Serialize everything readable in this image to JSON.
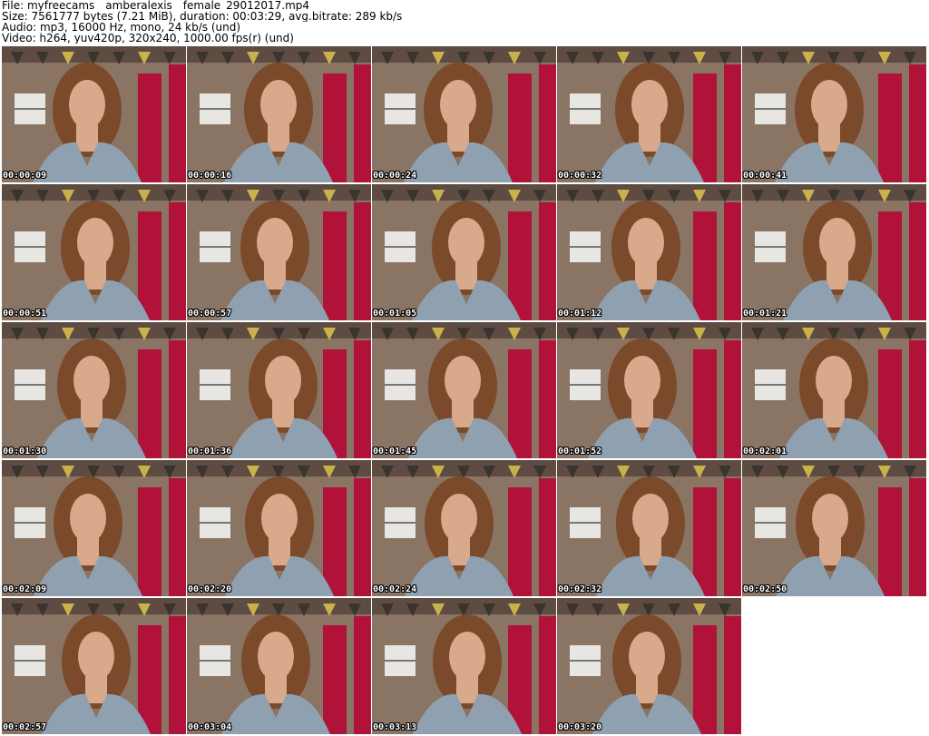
{
  "header": {
    "file_line": "File: myfreecams__amberalexis__female_29012017.mp4",
    "size_line": "Size: 7561777 bytes (7.21 MiB), duration: 00:03:29, avg.bitrate: 289 kb/s",
    "audio_line": "Audio: mp3, 16000 Hz, mono, 24 kb/s (und)",
    "video_line": "Video: h264, yuv420p, 320x240, 1000.00 fps(r) (und)"
  },
  "thumbnails": [
    {
      "timestamp": "00:00:09"
    },
    {
      "timestamp": "00:00:16"
    },
    {
      "timestamp": "00:00:24"
    },
    {
      "timestamp": "00:00:32"
    },
    {
      "timestamp": "00:00:41"
    },
    {
      "timestamp": "00:00:51"
    },
    {
      "timestamp": "00:00:57"
    },
    {
      "timestamp": "00:01:05"
    },
    {
      "timestamp": "00:01:12"
    },
    {
      "timestamp": "00:01:21"
    },
    {
      "timestamp": "00:01:30"
    },
    {
      "timestamp": "00:01:36"
    },
    {
      "timestamp": "00:01:45"
    },
    {
      "timestamp": "00:01:52"
    },
    {
      "timestamp": "00:02:01"
    },
    {
      "timestamp": "00:02:09"
    },
    {
      "timestamp": "00:02:20"
    },
    {
      "timestamp": "00:02:24"
    },
    {
      "timestamp": "00:02:32"
    },
    {
      "timestamp": "00:02:50"
    },
    {
      "timestamp": "00:02:57"
    },
    {
      "timestamp": "00:03:04"
    },
    {
      "timestamp": "00:03:13"
    },
    {
      "timestamp": "00:03:20"
    }
  ],
  "colors": {
    "wall": "#8a7464",
    "ceiling": "#5e4c42",
    "curtain": "#b0123a",
    "hair": "#7a4a2a",
    "skin": "#d9a98c",
    "jacket": "#8fa0b0",
    "window": "#e8e6e2",
    "background": "#ffffff"
  }
}
